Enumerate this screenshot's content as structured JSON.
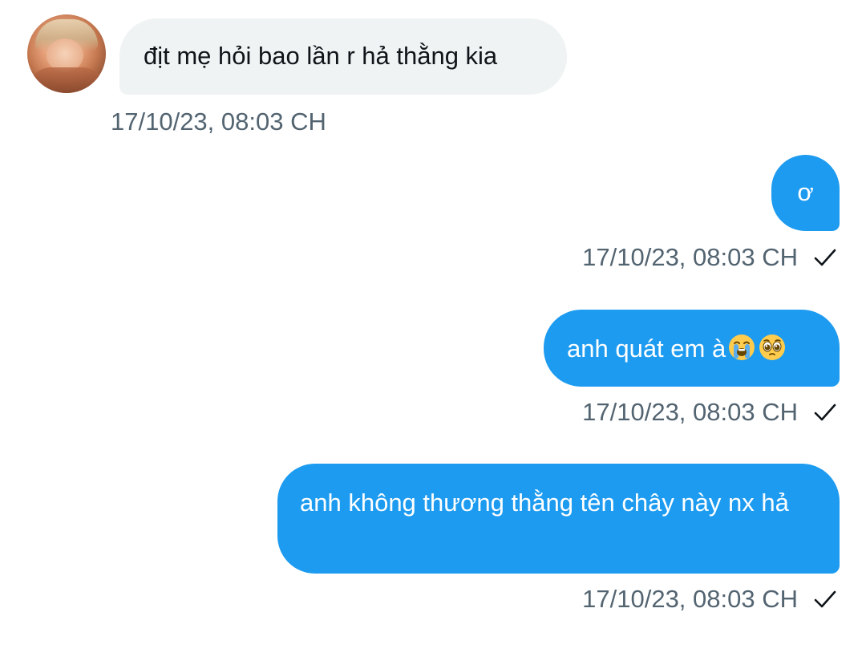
{
  "messages": [
    {
      "direction": "received",
      "text": "địt mẹ hỏi bao lần r hả thằng kia",
      "timestamp": "17/10/23, 08:03 CH"
    },
    {
      "direction": "sent",
      "text": "ơ",
      "timestamp": "17/10/23, 08:03 CH",
      "status_icon": "check-icon"
    },
    {
      "direction": "sent",
      "text": "anh quát em à",
      "emojis": [
        "loudly-crying-face-emoji",
        "pleading-face-emoji"
      ],
      "timestamp": "17/10/23, 08:03 CH",
      "status_icon": "check-icon"
    },
    {
      "direction": "sent",
      "text": "anh không thương thằng tên chây này nx hả",
      "timestamp": "17/10/23, 08:03 CH",
      "status_icon": "check-icon"
    }
  ],
  "colors": {
    "sent_bubble": "#1d9bf0",
    "received_bubble": "#eff3f4",
    "timestamp_text": "#536471",
    "message_text": "#0f1419"
  }
}
